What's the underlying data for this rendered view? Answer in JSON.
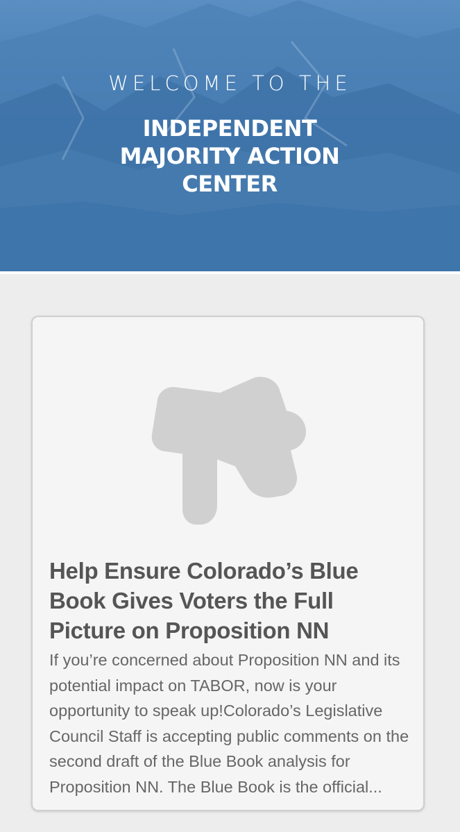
{
  "hero": {
    "subtitle": "WELCOME TO THE",
    "title": "INDEPENDENT MAJORITY ACTION CENTER"
  },
  "article": {
    "icon": "megaphone-icon",
    "title": "Help Ensure Colorado’s Blue Book Gives Voters the Full Picture on Proposition NN",
    "excerpt": "If you’re concerned about Proposition NN and its potential impact on TABOR, now is your opportunity to speak up!Colorado’s Legislative Council Staff is accepting public comments on the second draft of the Blue Book analysis for Proposition NN. The Blue Book is the official..."
  },
  "colors": {
    "hero_blue": "#3f78b0",
    "page_background": "#ededed",
    "card_background": "#f5f5f5",
    "title_text": "#555555",
    "body_text": "#666666",
    "icon_gray": "#d0d0d0"
  }
}
